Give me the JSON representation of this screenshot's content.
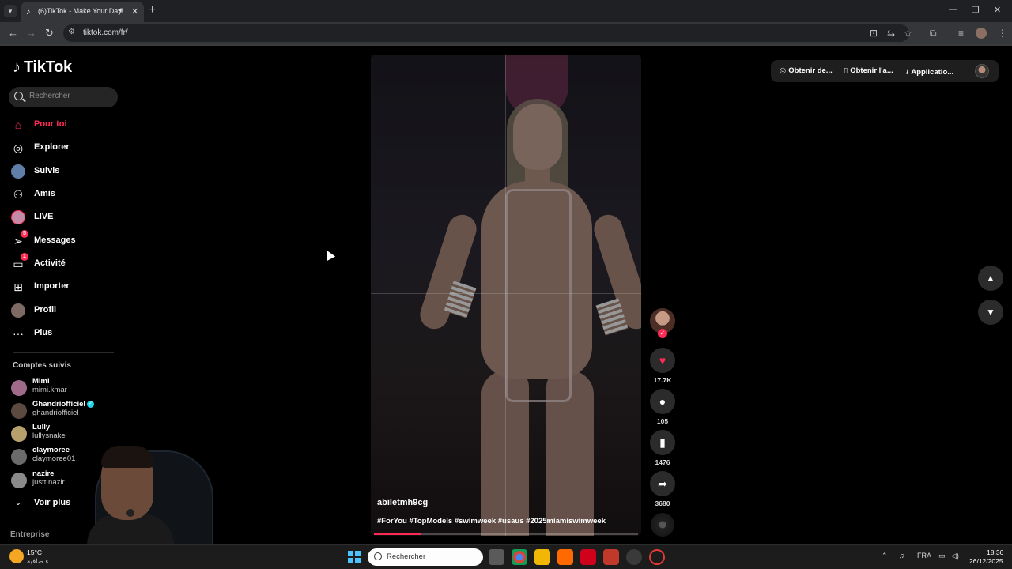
{
  "browser": {
    "tab_title": "(6)TikTok - Make Your Day",
    "tab_favicon": "tiktok-favicon",
    "url": "tiktok.com/fr/"
  },
  "sidebar": {
    "logo_text": "TikTok",
    "search_placeholder": "Rechercher",
    "nav": [
      {
        "label": "Pour toi",
        "icon": "home-icon",
        "active": true
      },
      {
        "label": "Explorer",
        "icon": "compass-icon"
      },
      {
        "label": "Suivis",
        "icon": "following-avatar-icon"
      },
      {
        "label": "Amis",
        "icon": "friends-icon"
      },
      {
        "label": "LIVE",
        "icon": "live-avatar-icon"
      },
      {
        "label": "Messages",
        "icon": "send-icon",
        "badge": "5"
      },
      {
        "label": "Activité",
        "icon": "inbox-icon",
        "badge": "1"
      },
      {
        "label": "Importer",
        "icon": "plus-square-icon"
      },
      {
        "label": "Profil",
        "icon": "profile-avatar-icon"
      },
      {
        "label": "Plus",
        "icon": "more-dots-icon"
      }
    ],
    "following_title": "Comptes suivis",
    "following": [
      {
        "name": "Mimi",
        "username": "mimi.kmar",
        "verified": false
      },
      {
        "name": "Ghandriofficiel",
        "username": "ghandriofficiel",
        "verified": true
      },
      {
        "name": "Lully",
        "username": "lullysnake",
        "verified": false
      },
      {
        "name": "claymoree",
        "username": "claymoree01",
        "verified": false
      },
      {
        "name": "nazire",
        "username": "justt.nazir",
        "verified": false
      }
    ],
    "see_more": "Voir plus",
    "company": "Entreprise"
  },
  "video": {
    "author": "abiletmh9cg",
    "caption": "#ForYou #TopModels #swimweek #usaus #2025miamiswimweek",
    "progress": 0.18
  },
  "actions": {
    "likes": "17.7K",
    "comments": "105",
    "saves": "1476",
    "shares": "3680"
  },
  "top_bar": {
    "item1": "Obtenir de...",
    "item2": "Obtenir l'a...",
    "item3": "Applicatio..."
  },
  "taskbar": {
    "weather_temp": "15°C",
    "weather_desc": "ء صافية",
    "search_placeholder": "Rechercher",
    "language": "FRA",
    "time": "18:36",
    "date": "26/12/2025"
  },
  "colors": {
    "accent": "#fe2c55",
    "background": "#000000",
    "verified": "#20d5ec"
  }
}
